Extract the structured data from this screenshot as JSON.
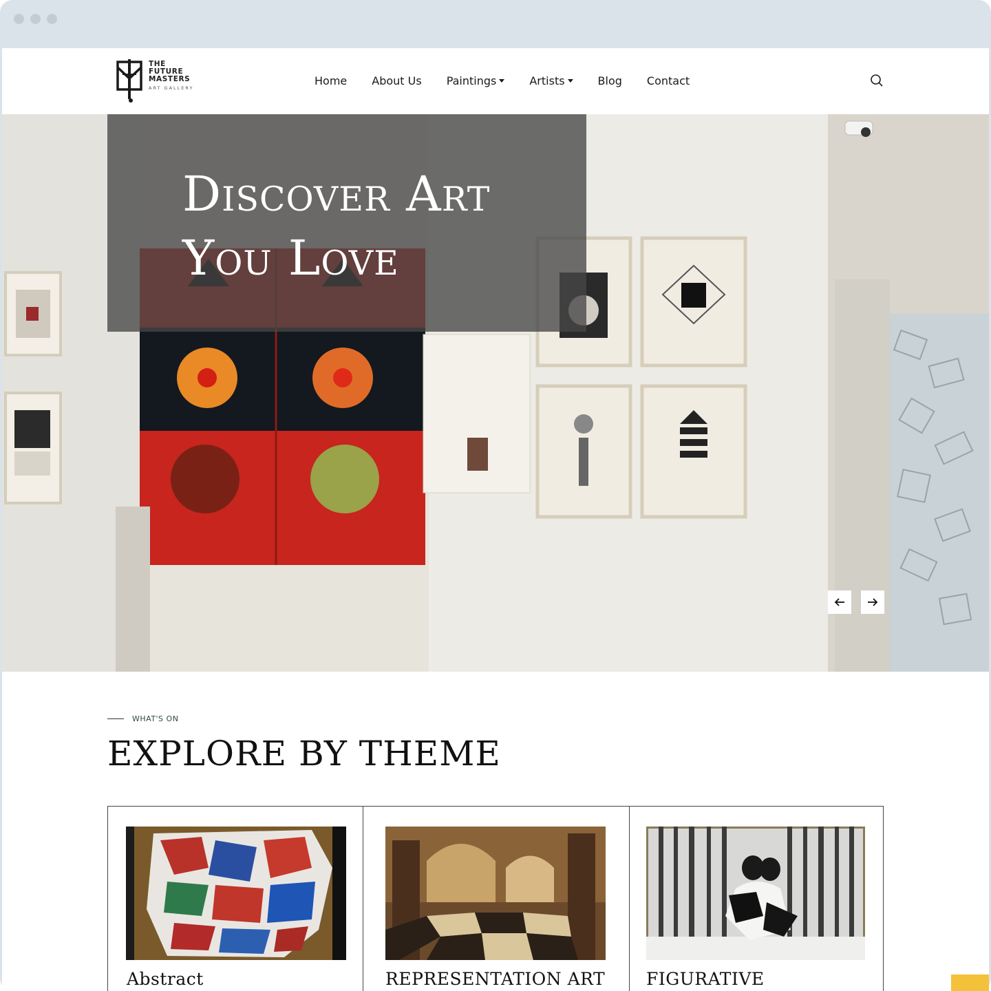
{
  "brand": {
    "line1": "THE",
    "line2": "FUTURE",
    "line3": "MASTERS",
    "sub": "ART GALLERY"
  },
  "nav": {
    "items": [
      {
        "label": "Home",
        "dropdown": false
      },
      {
        "label": "About Us",
        "dropdown": false
      },
      {
        "label": "Paintings",
        "dropdown": true
      },
      {
        "label": "Artists",
        "dropdown": true
      },
      {
        "label": "Blog",
        "dropdown": false
      },
      {
        "label": "Contact",
        "dropdown": false
      }
    ],
    "search_icon": "search-icon"
  },
  "hero": {
    "title_line1": "Discover Art",
    "title_line2": "You Love",
    "prev_icon": "arrow-left-icon",
    "next_icon": "arrow-right-icon"
  },
  "section": {
    "tag": "WHAT'S ON",
    "title": "EXPLORE BY THEME"
  },
  "themes": [
    {
      "label": "Abstract"
    },
    {
      "label": "REPRESENTATION ART"
    },
    {
      "label": "FIGURATIVE"
    }
  ],
  "colors": {
    "accent": "#f4c13a",
    "tag_text": "#2d4b3a",
    "overlay": "#464646"
  }
}
